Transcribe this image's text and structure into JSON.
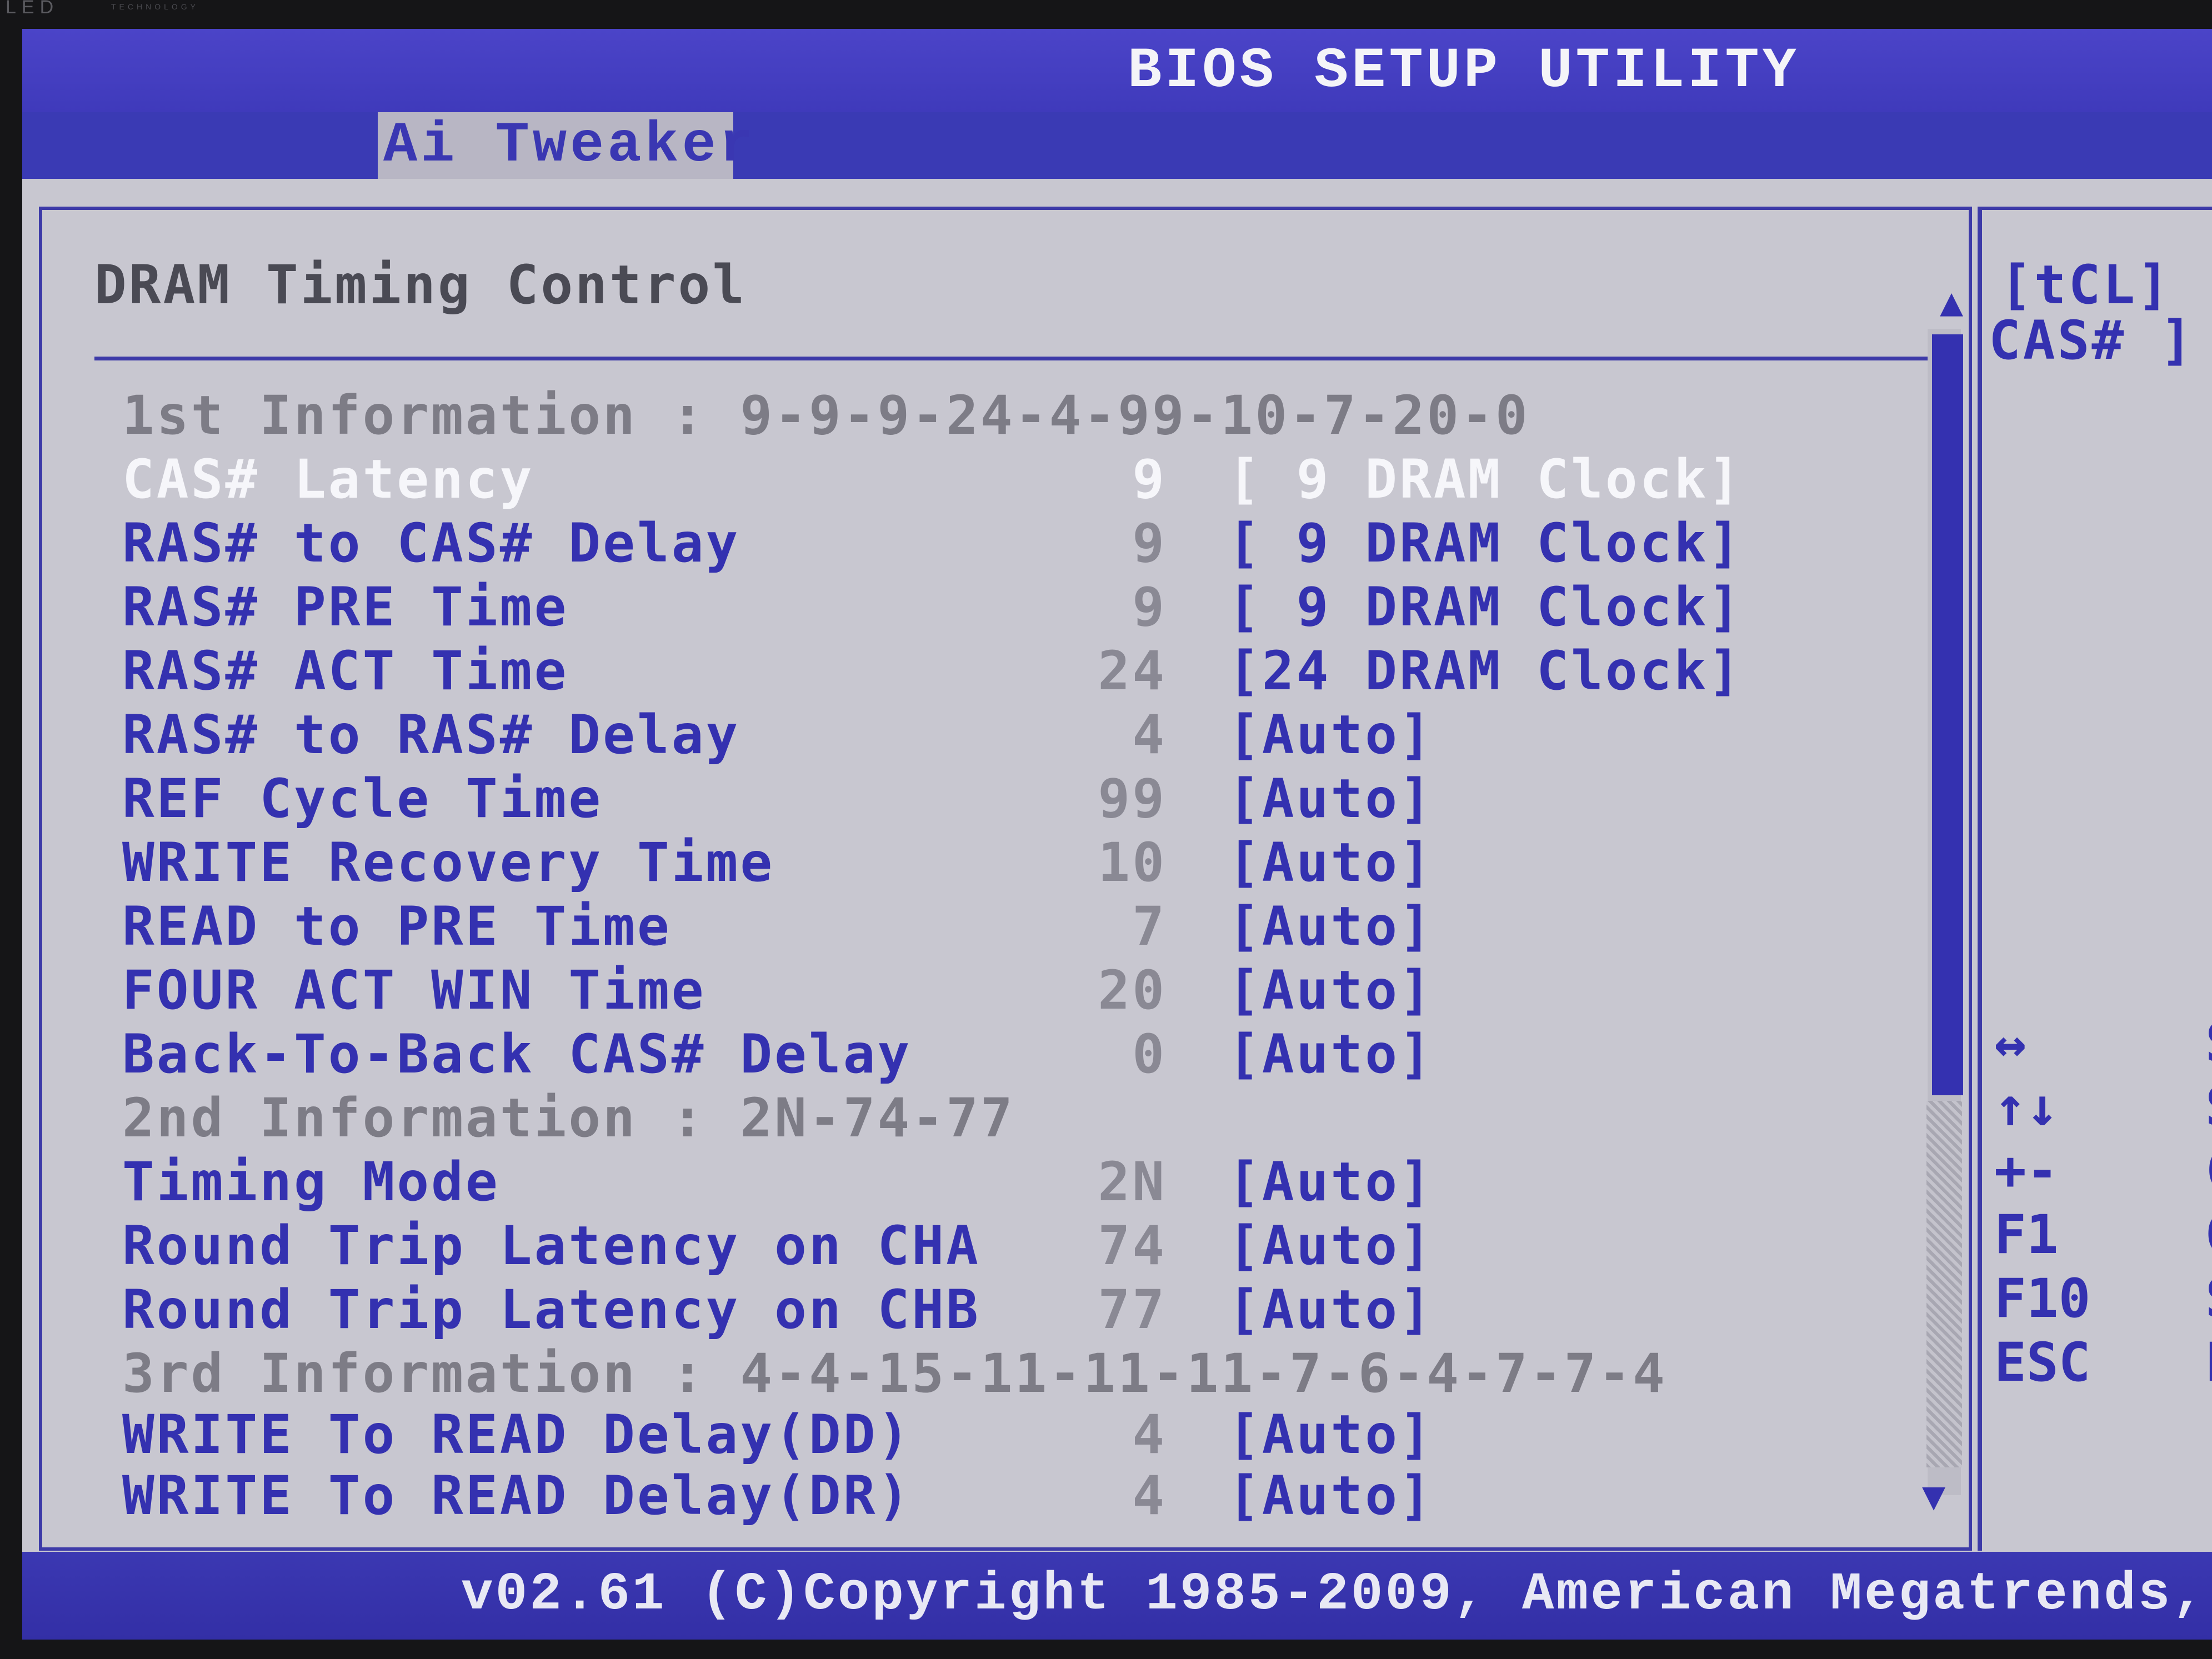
{
  "bezel": {
    "logo": "LED",
    "logo_sub": "TECHNOLOGY"
  },
  "app": {
    "title": "BIOS SETUP UTILITY",
    "active_tab": "Ai Tweaker"
  },
  "section": {
    "title": "DRAM Timing Control"
  },
  "rows": [
    {
      "type": "info",
      "label": "1st Information : 9-9-9-24-4-99-10-7-20-0"
    },
    {
      "type": "item",
      "label": "CAS# Latency",
      "current": "9",
      "setting": "[ 9 DRAM Clock]",
      "selected": true
    },
    {
      "type": "item",
      "label": "RAS# to CAS# Delay",
      "current": "9",
      "setting": "[ 9 DRAM Clock]"
    },
    {
      "type": "item",
      "label": "RAS# PRE Time",
      "current": "9",
      "setting": "[ 9 DRAM Clock]"
    },
    {
      "type": "item",
      "label": "RAS# ACT Time",
      "current": "24",
      "setting": "[24 DRAM Clock]"
    },
    {
      "type": "item",
      "label": "RAS# to RAS# Delay",
      "current": "4",
      "setting": "[Auto]"
    },
    {
      "type": "item",
      "label": "REF Cycle Time",
      "current": "99",
      "setting": "[Auto]"
    },
    {
      "type": "item",
      "label": "WRITE Recovery Time",
      "current": "10",
      "setting": "[Auto]"
    },
    {
      "type": "item",
      "label": "READ to PRE Time",
      "current": "7",
      "setting": "[Auto]"
    },
    {
      "type": "item",
      "label": "FOUR ACT WIN Time",
      "current": "20",
      "setting": "[Auto]"
    },
    {
      "type": "item",
      "label": "Back-To-Back CAS# Delay",
      "current": "0",
      "setting": "[Auto]"
    },
    {
      "type": "info",
      "label": "2nd Information : 2N-74-77"
    },
    {
      "type": "item",
      "label": "Timing Mode",
      "current": "2N",
      "setting": "[Auto]"
    },
    {
      "type": "item",
      "label": "Round Trip Latency on CHA",
      "current": "74",
      "setting": "[Auto]"
    },
    {
      "type": "item",
      "label": "Round Trip Latency on CHB",
      "current": "77",
      "setting": "[Auto]"
    },
    {
      "type": "info",
      "label": "3rd Information : 4-4-15-11-11-11-7-6-4-7-7-4"
    },
    {
      "type": "item",
      "label": "WRITE To READ Delay(DD)",
      "current": "4",
      "setting": "[Auto]"
    },
    {
      "type": "item",
      "label": "WRITE To READ Delay(DR)",
      "current": "4",
      "setting": "[Auto]"
    }
  ],
  "help": {
    "line1": "[tCL]",
    "line2": "CAS# ]"
  },
  "keys": [
    {
      "key": "↔",
      "desc": "S",
      "icon": "left-right-arrows-icon"
    },
    {
      "key": "↑↓",
      "desc": "S",
      "icon": "up-down-arrows-icon"
    },
    {
      "key": "+-",
      "desc": "C",
      "icon": "plus-minus-icon"
    },
    {
      "key": "F1",
      "desc": "G"
    },
    {
      "key": "F10",
      "desc": "S"
    },
    {
      "key": "ESC",
      "desc": "E"
    }
  ],
  "scrollbar": {
    "up_icon": "▲",
    "down_icon": "▼"
  },
  "footer": {
    "text": "v02.61 (C)Copyright 1985-2009, American Megatrends,"
  },
  "colors": {
    "screen_bg": "#c8c7d0",
    "title_bar": "#4b44c8",
    "item_text": "#3431b0",
    "info_text": "#7d7c86",
    "selected_text": "#f6f6fa"
  }
}
